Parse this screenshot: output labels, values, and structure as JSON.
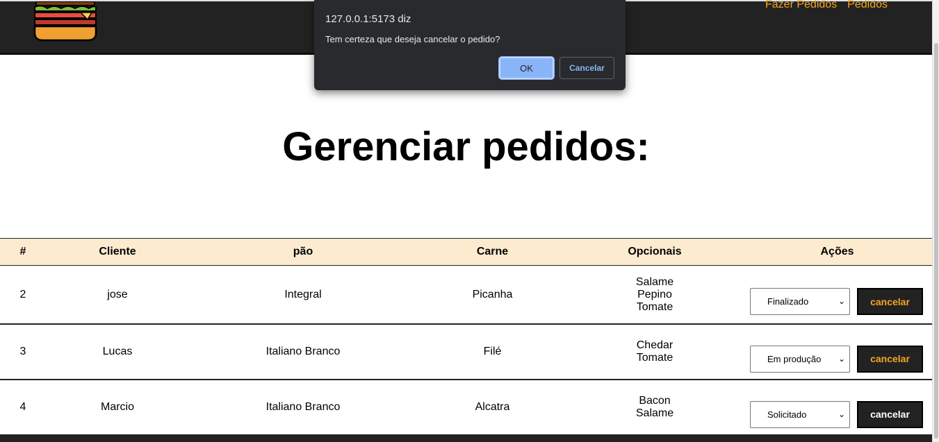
{
  "nav": {
    "links": [
      "Fazer Pedidos",
      "Pedidos"
    ],
    "accent_color": "#f5a623",
    "logo_icon": "burger-icon"
  },
  "page": {
    "title": "Gerenciar pedidos:"
  },
  "table": {
    "headers": [
      "#",
      "Cliente",
      "pão",
      "Carne",
      "Opcionais",
      "Ações"
    ],
    "rows": [
      {
        "id": "2",
        "cliente": "jose",
        "pao": "Integral",
        "carne": "Picanha",
        "opcionais": [
          "Salame",
          "Pepino",
          "Tomate"
        ],
        "status": "Finalizado",
        "cancel_label": "cancelar",
        "cancel_color": "#f5a623"
      },
      {
        "id": "3",
        "cliente": "Lucas",
        "pao": "Italiano Branco",
        "carne": "Filé",
        "opcionais": [
          "Chedar",
          "Tomate"
        ],
        "status": "Em produção",
        "cancel_label": "cancelar",
        "cancel_color": "#f5a623"
      },
      {
        "id": "4",
        "cliente": "Marcio",
        "pao": "Italiano Branco",
        "carne": "Alcatra",
        "opcionais": [
          "Bacon",
          "Salame"
        ],
        "status": "Solicitado",
        "cancel_label": "cancelar",
        "cancel_color": "#ffffff"
      }
    ]
  },
  "dialog": {
    "origin": "127.0.0.1:5173 diz",
    "message": "Tem certeza que deseja cancelar o pedido?",
    "ok_label": "OK",
    "cancel_label": "Cancelar"
  }
}
